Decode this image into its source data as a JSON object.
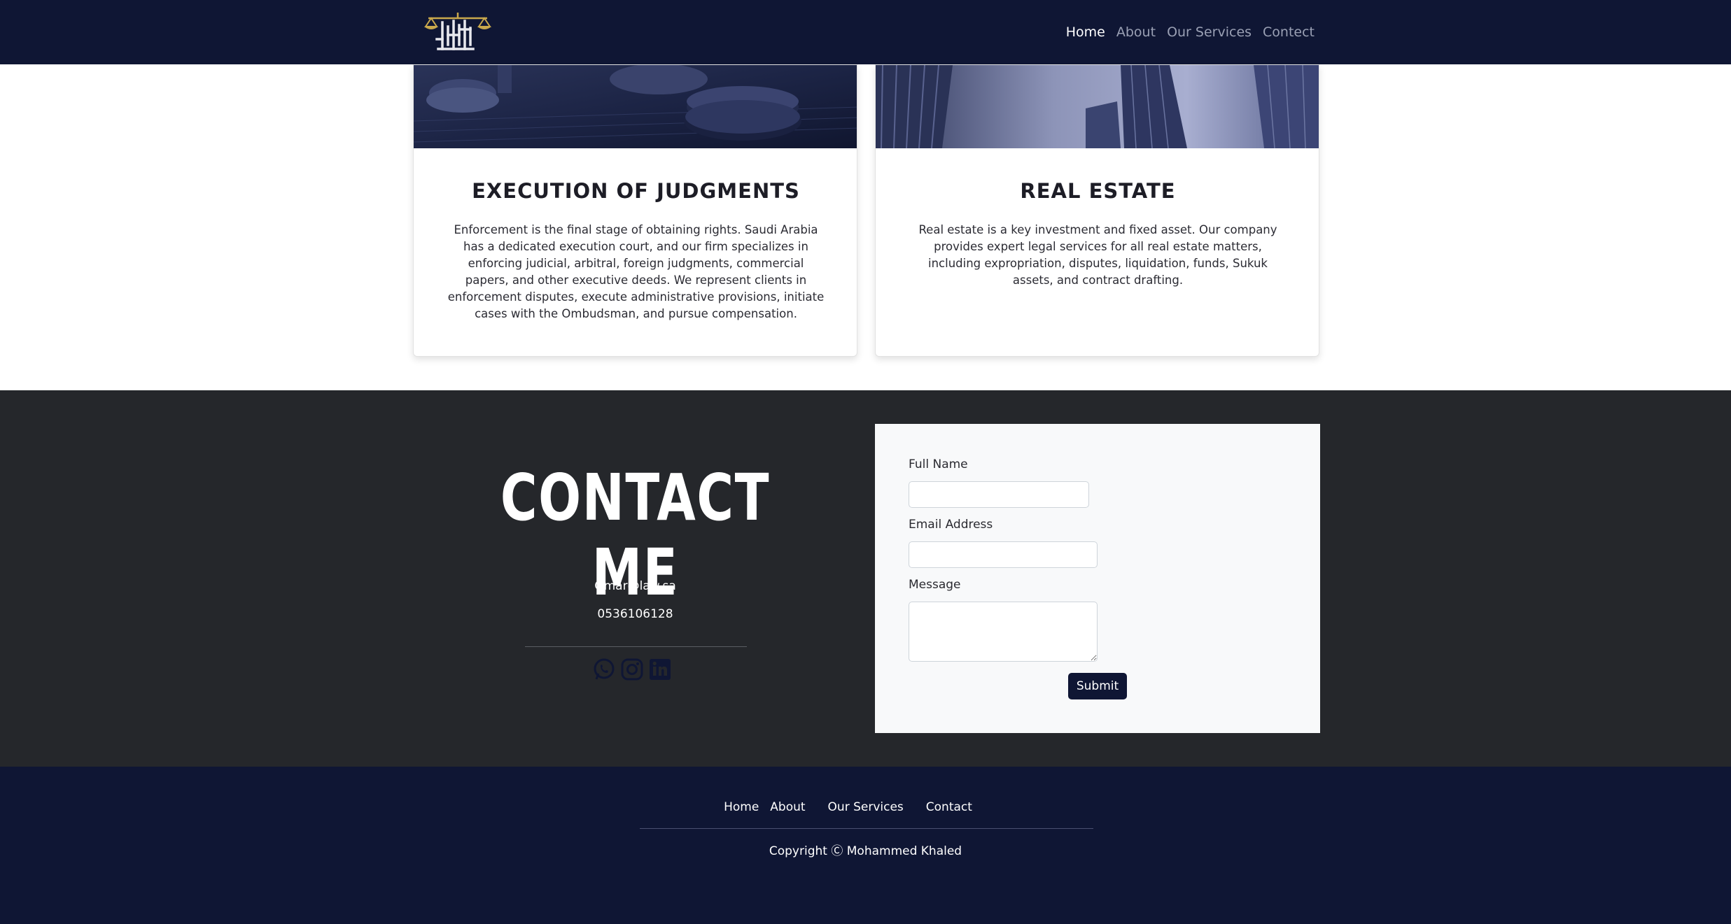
{
  "nav": {
    "links": [
      "Home",
      "About",
      "Our Services",
      "Contect"
    ]
  },
  "services": [
    {
      "title": "EXECUTION OF JUDGMENTS",
      "text": "Enforcement is the final stage of obtaining rights. Saudi Arabia has a dedicated execution court, and our firm specializes in enforcing judicial, arbitral, foreign judgments, commercial papers, and other executive deeds. We represent clients in enforcement disputes, execute administrative provisions, initiate cases with the Ombudsman, and pursue compensation."
    },
    {
      "title": "REAL ESTATE",
      "text": "Real estate is a key investment and fixed asset. Our company provides expert legal services for all real estate matters, including expropriation, disputes, liquidation, funds, Sukuk assets, and contract drafting."
    }
  ],
  "contact": {
    "title": "CONTACT ME",
    "email": "Omar@law.sa",
    "phone": "0536106128",
    "social_icons": [
      "whatsapp-icon",
      "instagram-icon",
      "linkedin-icon"
    ]
  },
  "form": {
    "name_label": "Full Name",
    "email_label": "Email Address",
    "message_label": "Message",
    "name_value": "",
    "email_value": "",
    "message_value": "",
    "submit_label": "Submit"
  },
  "footer": {
    "links": [
      "Home",
      "About",
      "Our Services",
      "Contact"
    ],
    "copyright": "Copyright Ⓒ Mohammed Khaled"
  },
  "colors": {
    "navy": "#0f1634",
    "dark": "#25272b",
    "light": "#f8f9fa",
    "logo_gold": "#c9a84c"
  }
}
